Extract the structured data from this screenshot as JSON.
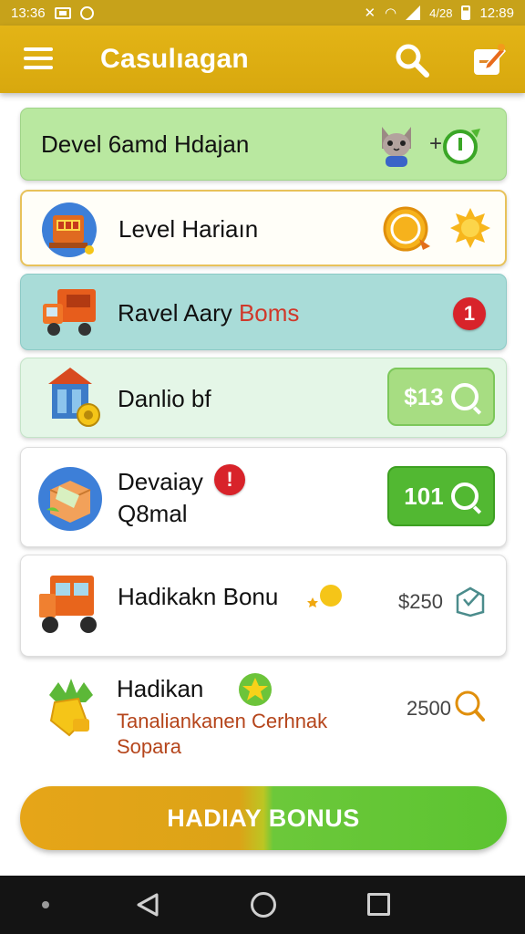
{
  "status_bar": {
    "time_left": "13:36",
    "time_right": "12:89",
    "network": "4/28"
  },
  "app_bar": {
    "title": "Casulıagan"
  },
  "cards": [
    {
      "title": "Devel 6amd Hdajan"
    },
    {
      "title": "Level Hariaın"
    },
    {
      "title_part1": "Ravel Aary ",
      "title_part2": "Boms",
      "badge": "1"
    },
    {
      "title": "Danlio bf",
      "button": "$13"
    },
    {
      "title": "Devaiay",
      "subtitle": "Q8mal",
      "badge": "!",
      "button": "101"
    },
    {
      "title": "Hadikakn Bonu",
      "amount": "$250"
    },
    {
      "title": "Hadikan",
      "desc_line1": "Tanaliankanen Cerhnak",
      "desc_line2": "Sopara",
      "amount": "2500"
    }
  ],
  "bonus_button": {
    "label": "HADIAY BONUS"
  },
  "colors": {
    "appbar": "#e3b416",
    "accent_green": "#52b832",
    "badge_red": "#d8232a",
    "orange_text": "#d88a0c"
  }
}
